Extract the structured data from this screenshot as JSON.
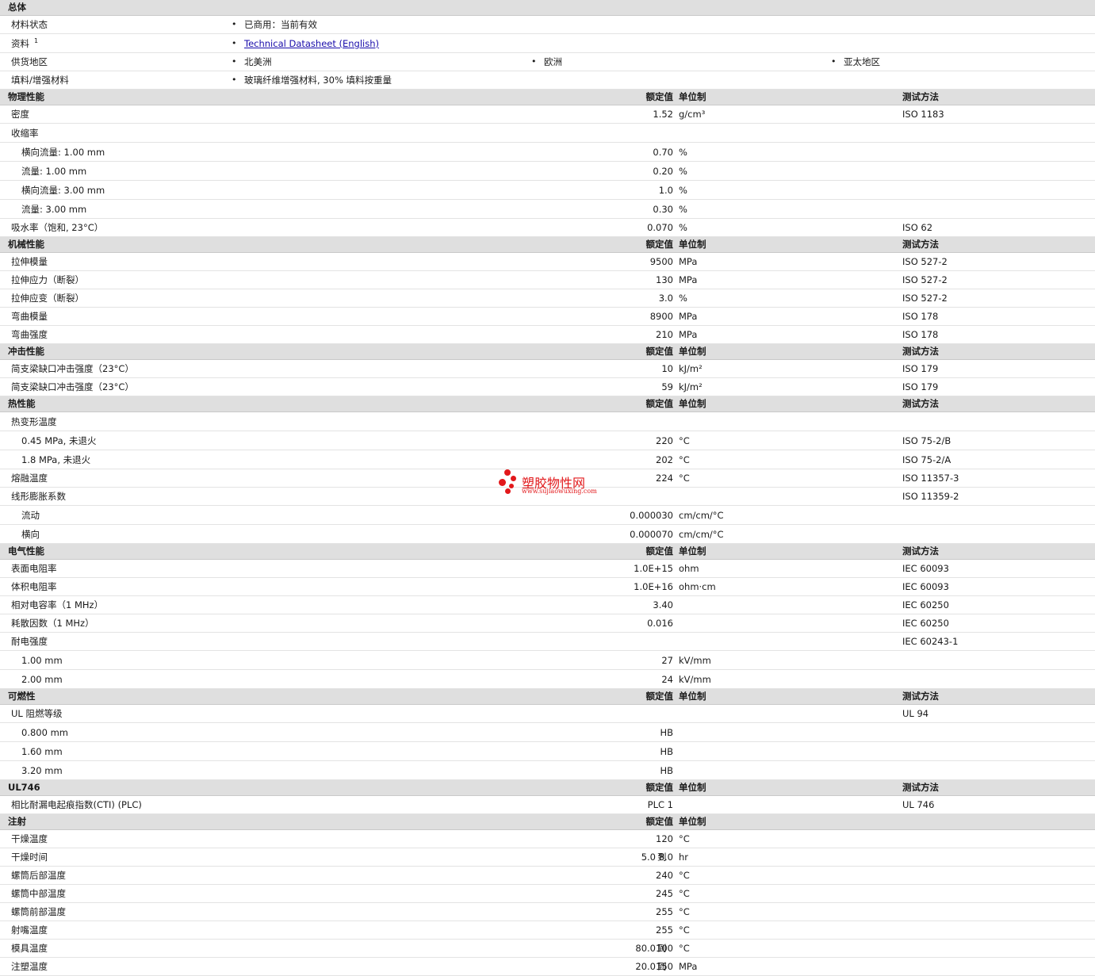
{
  "general": {
    "title": "总体",
    "rows": [
      {
        "label": "材料状态",
        "items": [
          "已商用：当前有效"
        ]
      },
      {
        "label": "资料",
        "sup": "1",
        "items": [
          "Technical Datasheet (English)"
        ]
      },
      {
        "label": "供货地区",
        "items": [
          "北美洲",
          "欧洲",
          "亚太地区"
        ]
      },
      {
        "label": "填料/增强材料",
        "items": [
          "玻璃纤维增强材料, 30% 填料按重量"
        ]
      }
    ]
  },
  "col_headers": {
    "value": "额定值",
    "unit": "单位制",
    "method": "测试方法"
  },
  "sections": [
    {
      "title": "物理性能",
      "rows": [
        {
          "label": "密度",
          "value": "1.52",
          "unit": "g/cm³",
          "method": "ISO 1183"
        },
        {
          "label": "收缩率",
          "value": "",
          "unit": "",
          "method": ""
        },
        {
          "label": "横向流量: 1.00 mm",
          "indent": true,
          "value": "0.70",
          "unit": "%",
          "method": ""
        },
        {
          "label": "流量: 1.00 mm",
          "indent": true,
          "value": "0.20",
          "unit": "%",
          "method": ""
        },
        {
          "label": "横向流量: 3.00 mm",
          "indent": true,
          "value": "1.0",
          "unit": "%",
          "method": ""
        },
        {
          "label": "流量: 3.00 mm",
          "indent": true,
          "value": "0.30",
          "unit": "%",
          "method": ""
        },
        {
          "label": "吸水率（饱和, 23°C）",
          "value": "0.070",
          "unit": "%",
          "method": "ISO 62"
        }
      ]
    },
    {
      "title": "机械性能",
      "rows": [
        {
          "label": "拉伸模量",
          "value": "9500",
          "unit": "MPa",
          "method": "ISO 527-2"
        },
        {
          "label": "拉伸应力（断裂）",
          "value": "130",
          "unit": "MPa",
          "method": "ISO 527-2"
        },
        {
          "label": "拉伸应变（断裂）",
          "value": "3.0",
          "unit": "%",
          "method": "ISO 527-2"
        },
        {
          "label": "弯曲模量",
          "value": "8900",
          "unit": "MPa",
          "method": "ISO 178"
        },
        {
          "label": "弯曲强度",
          "value": "210",
          "unit": "MPa",
          "method": "ISO 178"
        }
      ]
    },
    {
      "title": "冲击性能",
      "rows": [
        {
          "label": "简支梁缺口冲击强度（23°C）",
          "value": "10",
          "unit": "kJ/m²",
          "method": "ISO 179"
        },
        {
          "label": "简支梁缺口冲击强度（23°C）",
          "value": "59",
          "unit": "kJ/m²",
          "method": "ISO 179"
        }
      ]
    },
    {
      "title": "热性能",
      "rows": [
        {
          "label": "热变形温度",
          "value": "",
          "unit": "",
          "method": ""
        },
        {
          "label": "0.45 MPa, 未退火",
          "indent": true,
          "value": "220",
          "unit": "°C",
          "method": "ISO 75-2/B"
        },
        {
          "label": "1.8 MPa, 未退火",
          "indent": true,
          "value": "202",
          "unit": "°C",
          "method": "ISO 75-2/A"
        },
        {
          "label": "熔融温度",
          "value": "224",
          "unit": "°C",
          "method": "ISO 11357-3"
        },
        {
          "label": "线形膨胀系数",
          "value": "",
          "unit": "",
          "method": "ISO 11359-2"
        },
        {
          "label": "流动",
          "indent": true,
          "value": "0.000030",
          "unit": "cm/cm/°C",
          "method": ""
        },
        {
          "label": "横向",
          "indent": true,
          "value": "0.000070",
          "unit": "cm/cm/°C",
          "method": ""
        }
      ]
    },
    {
      "title": "电气性能",
      "rows": [
        {
          "label": "表面电阻率",
          "value": "1.0E+15",
          "unit": "ohm",
          "method": "IEC 60093"
        },
        {
          "label": "体积电阻率",
          "value": "1.0E+16",
          "unit": "ohm·cm",
          "method": "IEC 60093"
        },
        {
          "label": "相对电容率（1 MHz）",
          "value": "3.40",
          "unit": "",
          "method": "IEC 60250"
        },
        {
          "label": "耗散因数（1 MHz）",
          "value": "0.016",
          "unit": "",
          "method": "IEC 60250"
        },
        {
          "label": "耐电强度",
          "value": "",
          "unit": "",
          "method": "IEC 60243-1"
        },
        {
          "label": "1.00 mm",
          "indent": true,
          "value": "27",
          "unit": "kV/mm",
          "method": ""
        },
        {
          "label": "2.00 mm",
          "indent": true,
          "value": "24",
          "unit": "kV/mm",
          "method": ""
        }
      ]
    },
    {
      "title": "可燃性",
      "rows": [
        {
          "label": "UL 阻燃等级",
          "value": "",
          "unit": "",
          "method": "UL 94"
        },
        {
          "label": "0.800 mm",
          "indent": true,
          "value": "HB",
          "unit": "",
          "method": ""
        },
        {
          "label": "1.60 mm",
          "indent": true,
          "value": "HB",
          "unit": "",
          "method": ""
        },
        {
          "label": "3.20 mm",
          "indent": true,
          "value": "HB",
          "unit": "",
          "method": ""
        }
      ]
    },
    {
      "title": "UL746",
      "rows": [
        {
          "label": "相比耐漏电起痕指数(CTI) (PLC)",
          "value": "PLC 1",
          "unit": "",
          "method": "UL 746"
        }
      ]
    },
    {
      "title": "注射",
      "no_method": true,
      "rows": [
        {
          "label": "干燥温度",
          "value": "120",
          "unit": "°C",
          "method": ""
        },
        {
          "label": "干燥时间",
          "value_lo": "5.0",
          "to": "到",
          "value_hi": "8.0",
          "unit": "hr",
          "method": ""
        },
        {
          "label": "螺筒后部温度",
          "value": "240",
          "unit": "°C",
          "method": ""
        },
        {
          "label": "螺筒中部温度",
          "value": "245",
          "unit": "°C",
          "method": ""
        },
        {
          "label": "螺筒前部温度",
          "value": "255",
          "unit": "°C",
          "method": ""
        },
        {
          "label": "射嘴温度",
          "value": "255",
          "unit": "°C",
          "method": ""
        },
        {
          "label": "模具温度",
          "value_lo": "80.0",
          "to": "到",
          "value_hi": "100",
          "unit": "°C",
          "method": ""
        },
        {
          "label": "注塑温度",
          "value_lo": "20.0",
          "to": "到",
          "value_hi": "150",
          "unit": "MPa",
          "method": ""
        }
      ]
    }
  ],
  "watermark": {
    "name": "塑胶物性网",
    "url": "www.sujiaowuxing.com",
    "color": "#e2181b"
  }
}
